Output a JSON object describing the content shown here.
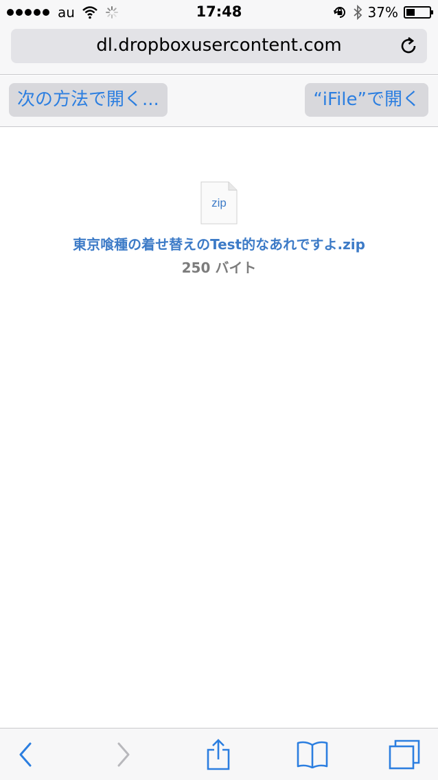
{
  "status_bar": {
    "carrier": "au",
    "time": "17:48",
    "battery_percent": "37%",
    "battery_level": 0.37
  },
  "browser": {
    "url": "dl.dropboxusercontent.com"
  },
  "open_bar": {
    "open_in_label": "次の方法で開く...",
    "open_in_app_label": "“iFile”で開く"
  },
  "file": {
    "icon_label": "zip",
    "name": "東京喰種の着せ替えのTest的なあれですよ.zip",
    "size": "250 バイト"
  },
  "toolbar": {
    "icons": [
      "back-icon",
      "forward-icon",
      "share-icon",
      "bookmarks-icon",
      "tabs-icon"
    ]
  },
  "colors": {
    "accent": "#2b7ee0",
    "file_name": "#3d7bc7",
    "disabled": "#b8b8bc"
  }
}
